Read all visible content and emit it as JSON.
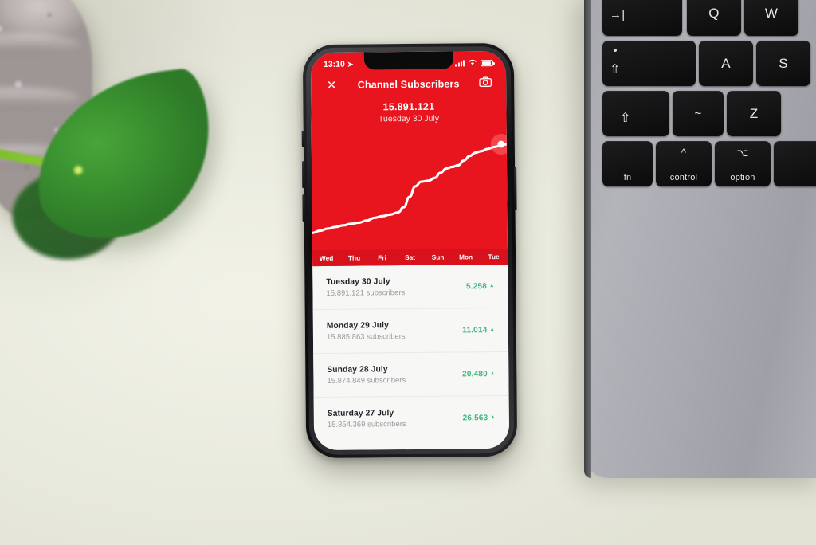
{
  "scene": {
    "background_color": "#edeee1",
    "objects": {
      "plant_pot": "stone-speckled-pot",
      "leaf": "pilea-leaf",
      "laptop": "silver-macbook"
    }
  },
  "laptop": {
    "keys": [
      {
        "name": "tab",
        "glyph": "→|",
        "label": ""
      },
      {
        "name": "caps-lock",
        "glyph": "⇧",
        "label": ""
      },
      {
        "name": "shift",
        "glyph": "⇧",
        "label": ""
      },
      {
        "name": "fn",
        "glyph": "",
        "label": "fn"
      },
      {
        "name": "control",
        "glyph": "^",
        "label": "control"
      },
      {
        "name": "option",
        "glyph": "⌥",
        "label": "option"
      },
      {
        "name": "q",
        "glyph": "Q",
        "label": ""
      },
      {
        "name": "w",
        "glyph": "W",
        "label": ""
      },
      {
        "name": "a",
        "glyph": "A",
        "label": ""
      },
      {
        "name": "s",
        "glyph": "S",
        "label": ""
      },
      {
        "name": "tilde",
        "glyph": "~",
        "label": ""
      },
      {
        "name": "z",
        "glyph": "Z",
        "label": ""
      }
    ]
  },
  "phone": {
    "status_bar": {
      "time": "13:10",
      "location_icon": "location-arrow-icon",
      "signal_icon": "cellular-bars-icon",
      "wifi_icon": "wifi-icon",
      "battery_icon": "battery-icon"
    },
    "navbar": {
      "close_icon": "close-icon",
      "title": "Channel Subscribers",
      "camera_icon": "camera-icon"
    },
    "summary": {
      "count": "15.891.121",
      "date": "Tuesday 30 July"
    },
    "home_indicator": "home-indicator-bar"
  },
  "chart_data": {
    "type": "line",
    "title": "Channel Subscribers",
    "xlabel": "",
    "ylabel": "",
    "grid": false,
    "legend": false,
    "line_color": "#ffffff",
    "background_color": "#e8151f",
    "categories": [
      "Wed",
      "Thu",
      "Fri",
      "Sat",
      "Sun",
      "Mon",
      "Tue"
    ],
    "x": [
      0,
      1,
      2,
      3,
      4,
      5,
      6
    ],
    "values": [
      15740000,
      15772000,
      15800000,
      15845000,
      15875000,
      15886000,
      15891121
    ],
    "ylim": [
      15730000,
      15900000
    ],
    "highlight_point": {
      "x": 6,
      "label": "Tue",
      "value": 15891121,
      "marker": "white-dot-with-halo"
    },
    "series": [
      {
        "name": "Subscribers",
        "points_normalized": [
          [
            0.0,
            0.06
          ],
          [
            0.04,
            0.08
          ],
          [
            0.08,
            0.1
          ],
          [
            0.12,
            0.115
          ],
          [
            0.16,
            0.13
          ],
          [
            0.2,
            0.145
          ],
          [
            0.24,
            0.155
          ],
          [
            0.28,
            0.175
          ],
          [
            0.32,
            0.2
          ],
          [
            0.36,
            0.215
          ],
          [
            0.4,
            0.23
          ],
          [
            0.44,
            0.25
          ],
          [
            0.47,
            0.3
          ],
          [
            0.5,
            0.4
          ],
          [
            0.53,
            0.5
          ],
          [
            0.56,
            0.545
          ],
          [
            0.6,
            0.555
          ],
          [
            0.63,
            0.58
          ],
          [
            0.66,
            0.63
          ],
          [
            0.69,
            0.67
          ],
          [
            0.72,
            0.685
          ],
          [
            0.75,
            0.7
          ],
          [
            0.78,
            0.745
          ],
          [
            0.81,
            0.79
          ],
          [
            0.84,
            0.82
          ],
          [
            0.87,
            0.835
          ],
          [
            0.9,
            0.855
          ],
          [
            0.94,
            0.875
          ],
          [
            0.97,
            0.89
          ],
          [
            1.0,
            0.9
          ]
        ]
      }
    ]
  },
  "list": {
    "rows": [
      {
        "date": "Tuesday 30 July",
        "subscribers": "15.891.121 subscribers",
        "delta": "5.258",
        "trend": "up"
      },
      {
        "date": "Monday 29 July",
        "subscribers": "15.885.863 subscribers",
        "delta": "11.014",
        "trend": "up"
      },
      {
        "date": "Sunday 28 July",
        "subscribers": "15.874.849 subscribers",
        "delta": "20.480",
        "trend": "up"
      },
      {
        "date": "Saturday 27 July",
        "subscribers": "15.854.369 subscribers",
        "delta": "26.563",
        "trend": "up"
      }
    ],
    "trend_up_glyph": "▲",
    "positive_color": "#3bbb7e"
  },
  "colors": {
    "brand_red": "#e8151f",
    "day_strip_red": "#d8121c",
    "positive_green": "#3bbb7e",
    "list_bg": "#f7f7f5",
    "desk": "#edeee1"
  }
}
